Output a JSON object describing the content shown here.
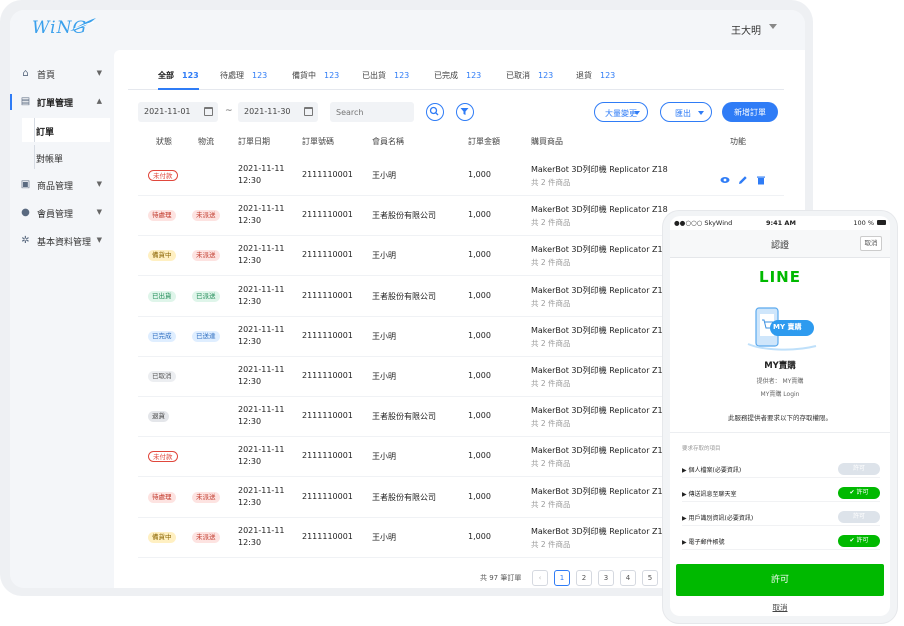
{
  "app": {
    "logo_text": "WiNG",
    "user_name": "王大明"
  },
  "colors": {
    "primary": "#2f7cf6",
    "line_green": "#00b900"
  },
  "sidebar": {
    "items": [
      {
        "label": "首頁",
        "icon": "home-icon"
      },
      {
        "label": "訂單管理",
        "icon": "order-icon",
        "active": true
      },
      {
        "label": "商品管理",
        "icon": "product-icon"
      },
      {
        "label": "會員管理",
        "icon": "members-icon"
      },
      {
        "label": "基本資料管理",
        "icon": "gear-icon"
      }
    ],
    "sub_items": [
      {
        "label": "訂單",
        "active": true
      },
      {
        "label": "對帳單"
      }
    ]
  },
  "tabs": [
    {
      "label": "全部",
      "count": "123",
      "active": true
    },
    {
      "label": "待處理",
      "count": "123"
    },
    {
      "label": "備貨中",
      "count": "123"
    },
    {
      "label": "已出貨",
      "count": "123"
    },
    {
      "label": "已完成",
      "count": "123"
    },
    {
      "label": "已取消",
      "count": "123"
    },
    {
      "label": "退貨",
      "count": "123"
    }
  ],
  "filters": {
    "date_from": "2021-11-01",
    "date_sep": "~",
    "date_to": "2021-11-30",
    "search_placeholder": "Search",
    "bulk_label": "大量變更",
    "export_label": "匯出",
    "new_label": "新增訂單"
  },
  "table": {
    "columns": [
      "狀態",
      "物流",
      "訂單日期",
      "訂單號碼",
      "會員名稱",
      "訂單金額",
      "購買商品",
      "功能"
    ],
    "rows": [
      {
        "status": "未付款",
        "logistics": "",
        "date": "2021-11-11",
        "time": "12:30",
        "number": "2111110001",
        "member": "王小明",
        "amount": "1,000",
        "product": "MakerBot 3D列印機 Replicator Z18",
        "qty": "共 2 件商品"
      },
      {
        "status": "待處理",
        "logistics": "未派送",
        "date": "2021-11-11",
        "time": "12:30",
        "number": "2111110001",
        "member": "王者股份有限公司",
        "amount": "1,000",
        "product": "MakerBot 3D列印機 Replicator Z18",
        "qty": "共 2 件商品"
      },
      {
        "status": "備貨中",
        "logistics": "未派送",
        "date": "2021-11-11",
        "time": "12:30",
        "number": "2111110001",
        "member": "王小明",
        "amount": "1,000",
        "product": "MakerBot 3D列印機 Replicator Z18",
        "qty": "共 2 件商品"
      },
      {
        "status": "已出貨",
        "logistics": "已派送",
        "date": "2021-11-11",
        "time": "12:30",
        "number": "2111110001",
        "member": "王者股份有限公司",
        "amount": "1,000",
        "product": "MakerBot 3D列印機 Replicator Z18",
        "qty": "共 2 件商品"
      },
      {
        "status": "已完成",
        "logistics": "已送達",
        "date": "2021-11-11",
        "time": "12:30",
        "number": "2111110001",
        "member": "王小明",
        "amount": "1,000",
        "product": "MakerBot 3D列印機 Replicator Z18",
        "qty": "共 2 件商品"
      },
      {
        "status": "已取消",
        "logistics": "",
        "date": "2021-11-11",
        "time": "12:30",
        "number": "2111110001",
        "member": "王小明",
        "amount": "1,000",
        "product": "MakerBot 3D列印機 Replicator Z18",
        "qty": "共 2 件商品"
      },
      {
        "status": "退貨",
        "logistics": "",
        "date": "2021-11-11",
        "time": "12:30",
        "number": "2111110001",
        "member": "王者股份有限公司",
        "amount": "1,000",
        "product": "MakerBot 3D列印機 Replicator Z18",
        "qty": "共 2 件商品"
      },
      {
        "status": "未付款",
        "logistics": "",
        "date": "2021-11-11",
        "time": "12:30",
        "number": "2111110001",
        "member": "王小明",
        "amount": "1,000",
        "product": "MakerBot 3D列印機 Replicator Z18",
        "qty": "共 2 件商品"
      },
      {
        "status": "待處理",
        "logistics": "未派送",
        "date": "2021-11-11",
        "time": "12:30",
        "number": "2111110001",
        "member": "王者股份有限公司",
        "amount": "1,000",
        "product": "MakerBot 3D列印機 Replicator Z18",
        "qty": "共 2 件商品"
      },
      {
        "status": "備貨中",
        "logistics": "未派送",
        "date": "2021-11-11",
        "time": "12:30",
        "number": "2111110001",
        "member": "王小明",
        "amount": "1,000",
        "product": "MakerBot 3D列印機 Replicator Z18",
        "qty": "共 2 件商品"
      }
    ]
  },
  "pagination": {
    "total": "共 97 筆訂單",
    "prev": "‹",
    "pages": [
      "1",
      "2",
      "3",
      "4",
      "5"
    ],
    "current": "1"
  },
  "phone": {
    "carrier": "●●○○○ SkyWind",
    "time": "9:41 AM",
    "battery": "100 %",
    "title": "認證",
    "cancel_small": "取消",
    "line_logo": "LINE",
    "illustration_text": "MY 賣購",
    "app_name": "MY賣購",
    "provider": "提供者： MY賣購",
    "app_login": "MY賣購 Login",
    "perm_note": "此服務提供者要求以下的存取權限。",
    "perm_head": "要求存取的項目",
    "perms": [
      {
        "label": "▶ 個人檔案(必要資訊)",
        "toggle": "許可",
        "on": false
      },
      {
        "label": "▶ 傳送訊息至聊天室",
        "toggle": "✔ 許可",
        "on": true
      },
      {
        "label": "▶ 用戶識別資訊(必要資訊)",
        "toggle": "許可",
        "on": false
      },
      {
        "label": "▶ 電子郵件帳號",
        "toggle": "✔ 許可",
        "on": true
      }
    ],
    "allow": "許可",
    "cancel": "取消"
  }
}
